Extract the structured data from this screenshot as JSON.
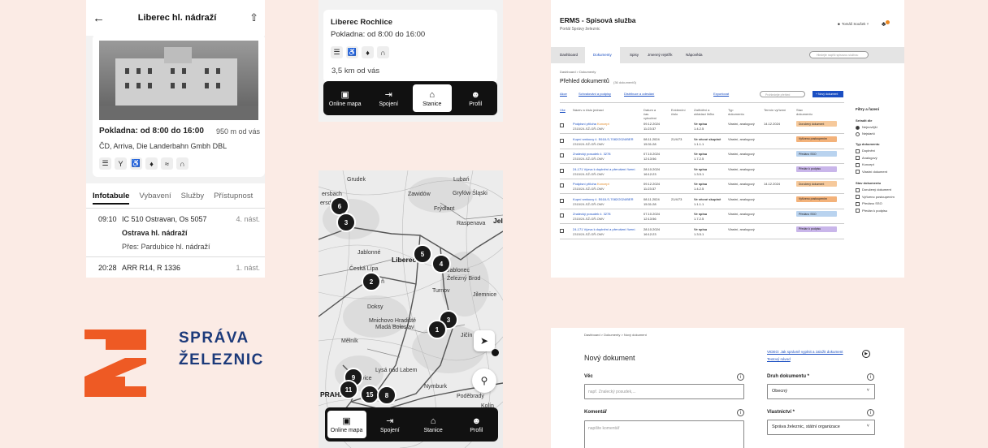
{
  "phone_detail": {
    "title": "Liberec hl. nádraží",
    "ticket_office": "Pokladna: od 8:00 do 16:00",
    "distance": "950 m od vás",
    "carriers": "ČD, Arriva, Die Landerbahn Gmbh DBL",
    "tabs": [
      "Infotabule",
      "Vybavení",
      "Služby",
      "Přístupnost"
    ],
    "departures": [
      {
        "time": "09:10",
        "train": "IC 510 Ostravan, Os 5057",
        "platform": "4. nást.",
        "destination": "Ostrava hl. nádraží",
        "via": "Přes: Pardubice hl. nádraží"
      },
      {
        "time": "20:28",
        "train": "ARR R14, R 1336",
        "platform": "1. nást."
      }
    ]
  },
  "phone_list": {
    "station": "Liberec Rochlice",
    "ticket_office": "Pokladna: od 8:00 do 16:00",
    "distance": "3,5 km od vás"
  },
  "bottom_nav": {
    "online_map": "Online mapa",
    "connection": "Spojení",
    "stations": "Stanice",
    "profile": "Profil"
  },
  "map": {
    "labels": {
      "bersbach": "ersbach",
      "leutersdorf": "ersdorf",
      "zawidow": "Zawidów",
      "grudek": "Grudek",
      "gryfow": "Gryfów Śląski",
      "lubani": "Lubań",
      "raspenava": "Raspenava",
      "jablonne": "Jablonné",
      "frydlant": "Frýdlant",
      "ceska_lipa": "Česká Lípa",
      "liberec": "Liberec",
      "jablonec": "Jablonec",
      "zelezny_brod": "Železný Brod",
      "turnov": "Turnov",
      "jelenia": "Jele",
      "mimon": "Mimoň",
      "mnichovo": "Mnichovo Hradiště",
      "doksy": "Doksy",
      "jicin": "Jičín",
      "mlada_boleslav": "Mladá Boleslav",
      "jilemnice": "Jilemnice",
      "melnik": "Mělník",
      "nymburk": "Nymburk",
      "neratovice": "Neratovice",
      "lysa": "Lysá nad Labem",
      "podebrady": "Poděbrady",
      "praha": "PRAHA",
      "kolin": "Kolín"
    },
    "clusters": {
      "c6": "6",
      "c3a": "3",
      "c5": "5",
      "c4": "4",
      "c2": "2",
      "c3b": "3",
      "c1": "1",
      "c9": "9",
      "c11": "11",
      "c15": "15",
      "c8": "8"
    }
  },
  "logo": {
    "line1": "SPRÁVA",
    "line2": "ŽELEZNIC",
    "color_orange": "#ee5a24",
    "color_blue": "#1c3a7a"
  },
  "erms": {
    "title": "ERMS - Spisová služba",
    "subtitle": "Portál Správy železnic",
    "user": "Tomáš Soušek",
    "nav": [
      "Dashboard",
      "Dokumenty",
      "Spisy",
      "Jmenný rejstřík",
      "Nápověda"
    ],
    "search_placeholder": "Hledejte napříč spisovou službou",
    "breadcrumb": "Dashboard > Dokumenty",
    "page_title": "Přehled dokumentů",
    "count": "(36 dokumentů)",
    "toolbar": [
      "Akce",
      "Schvalování a podpisy",
      "Distribuce a odeslání",
      "Exportovat"
    ],
    "quick_search": "Prohledejte přehled",
    "new_doc": "+ Nový dokument",
    "columns": [
      "Vše",
      "Název a číslo jednací",
      "Datum a čas vytvoření",
      "Evidenční číslo",
      "Zatřídění a ukládací lhůta",
      "Typ dokumentu",
      "Termín vyřízení",
      "Stav dokumentu"
    ],
    "rows": [
      {
        "name": "Podpisní příloha",
        "tag": "Koncept",
        "id": "2315/24-SŽ-GŘ-OMV",
        "date": "09.12.2024",
        "time": "11:23:37",
        "evid": "",
        "class": "Ve spisu",
        "class_code": "1.4.2.5",
        "type": "Vlastní, analogový",
        "term": "14.12.2024",
        "status": "Doručený dokument",
        "status_color": "#f6c99b"
      },
      {
        "name": "Kupní smlouvy č. E618-S-7082/2024/BER",
        "tag": "",
        "id": "2315/24-SŽ-GŘ-OMV",
        "date": "08.11.2024",
        "time": "15:31:28",
        "evid": "21/4/73",
        "class": "Ve věcné skupině",
        "class_code": "1.1.1.1",
        "type": "Vlastní, analogový",
        "term": "",
        "status": "Vyřízeno postoupením",
        "status_color": "#f3b27a"
      },
      {
        "name": "Znalecký posudek č. 3278",
        "tag": "",
        "id": "2315/24-SŽ-GŘ-OMV",
        "date": "07.10.2024",
        "time": "12:13:56",
        "evid": "",
        "class": "Ve spisu",
        "class_code": "1.7.2.5",
        "type": "Vlastní, analogový",
        "term": "",
        "status": "Předáno SSO",
        "status_color": "#b9d3ef"
      },
      {
        "name": "24-171 Výzva k doplnění a přerušení řízení (Povolení záměru)",
        "tag": "",
        "id": "2315/24-SŽ-GŘ-OMV",
        "date": "28.10.2024",
        "time": "16:12:23",
        "evid": "",
        "class": "Ve spisu",
        "class_code": "1.3.5.1",
        "type": "Vlastní, analogový",
        "term": "",
        "status": "Předán k podpisu",
        "status_color": "#c9b6ea"
      },
      {
        "name": "Podpisní příloha",
        "tag": "Koncept",
        "id": "2315/24-SŽ-GŘ-OMV",
        "date": "09.12.2024",
        "time": "11:23:37",
        "evid": "",
        "class": "Ve spisu",
        "class_code": "1.4.2.5",
        "type": "Vlastní, analogový",
        "term": "14.12.2024",
        "status": "Doručený dokument",
        "status_color": "#f6c99b"
      },
      {
        "name": "Kupní smlouvy č. E618-S-7082/2024/BER",
        "tag": "",
        "id": "2315/24-SŽ-GŘ-OMV",
        "date": "08.11.2024",
        "time": "15:31:28",
        "evid": "21/4/73",
        "class": "Ve věcné skupině",
        "class_code": "1.1.1.1",
        "type": "Vlastní, analogový",
        "term": "",
        "status": "Vyřízeno postoupením",
        "status_color": "#f3b27a"
      },
      {
        "name": "Znalecký posudek č. 3278",
        "tag": "",
        "id": "2315/24-SŽ-GŘ-OMV",
        "date": "07.10.2024",
        "time": "12:13:56",
        "evid": "",
        "class": "Ve spisu",
        "class_code": "1.7.2.5",
        "type": "Vlastní, analogový",
        "term": "",
        "status": "Předáno SSO",
        "status_color": "#b9d3ef"
      },
      {
        "name": "24-171 Výzva k doplnění a přerušení řízení (Povolení záměru)",
        "tag": "",
        "id": "2315/24-SŽ-GŘ-OMV",
        "date": "28.10.2024",
        "time": "16:12:23",
        "evid": "",
        "class": "Ve spisu",
        "class_code": "1.3.5.1",
        "type": "Vlastní, analogový",
        "term": "",
        "status": "Předán k podpisu",
        "status_color": "#c9b6ea"
      }
    ],
    "filters": {
      "title": "Filtry a řazení",
      "sort_title": "Seřadit dle",
      "sort": [
        "Nejnovější",
        "Nejstarší"
      ],
      "type_title": "Typ dokumentu",
      "types": [
        "Doplnění",
        "Analogový",
        "Koncept",
        "Vlastní dokument"
      ],
      "state_title": "Stav dokumentu",
      "states": [
        "Doručený dokument",
        "Vyřízeno postoupením",
        "Předáno SSO",
        "Předán k podpisu"
      ]
    }
  },
  "form": {
    "breadcrumb": "Dashboard > Dokumenty > Nový dokument",
    "title": "Nový dokument",
    "video_link": "VIDEO: Jak správně vyplnit a založit dokument",
    "text_link": "Textový návod",
    "subject_label": "Věc",
    "subject_placeholder": "např. Znalecký posudek,...",
    "comment_label": "Komentář",
    "comment_placeholder": "napište komentář",
    "doctype_label": "Druh dokumentu *",
    "doctype_value": "Obecný",
    "owner_label": "Vlastnictví *",
    "owner_value": "Správa železnic, státní organizace"
  }
}
